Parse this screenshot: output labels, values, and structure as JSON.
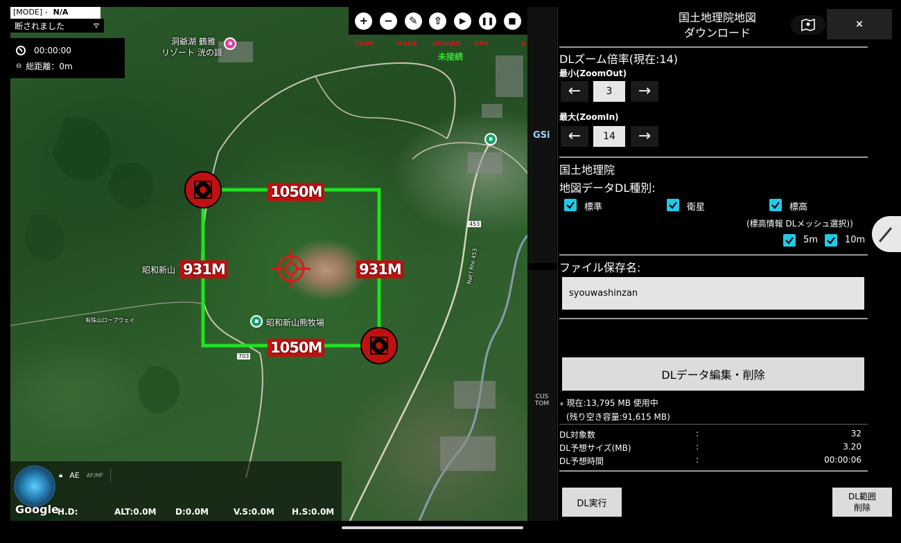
{
  "status": {
    "mode_label": "[MODE] -",
    "mode_value": "N/A",
    "connection": "断されました",
    "connection_glyph": "ᯤ",
    "timer": "00:00:00",
    "distance": "総距離：0m"
  },
  "toolbar": {
    "buttons": [
      "zoom-in",
      "zoom-out",
      "wrench",
      "upload",
      "play",
      "pause",
      "stop"
    ],
    "tags": [
      "TEMP",
      "MODE",
      "UPLOAD",
      "GPS",
      "S"
    ],
    "unconnected": "未接続"
  },
  "map": {
    "labels": {
      "hotel_line1": "洞爺湖 鶴雅",
      "hotel_line2": "リゾート 洸の謌",
      "mountain": "昭和新山",
      "ranch": "昭和新山熊牧場",
      "ropeway": "有珠山ロープウェイ",
      "route453": "453",
      "route453_vertical": "Nat'l Rte 453",
      "route703": "703"
    },
    "distances": {
      "top": "1050M",
      "bottom": "1050M",
      "left": "931M",
      "right": "931M"
    },
    "google": "Google",
    "colors": {
      "area_outline": "#22e022",
      "marker": "#c01010"
    }
  },
  "hud": {
    "ae": "AE",
    "af": "AF/MF",
    "hd": "H.D:",
    "alt": "ALT:0.0M",
    "d": "D:0.0M",
    "vs": "V.S:0.0M",
    "hs": "H.S:0.0M"
  },
  "strip": {
    "gsi": "GSi",
    "custom_1": "CUS",
    "custom_2": "TOM"
  },
  "panel": {
    "title_line1": "国土地理院地図",
    "title_line2": "ダウンロード",
    "close": "×",
    "zoom_title": "DLズーム倍率(現在:14)",
    "min_label": "最小(ZoomOut)",
    "min_value": "3",
    "max_label": "最大(ZoomIn)",
    "max_value": "14",
    "arrow_left": "←",
    "arrow_right": "→",
    "gsi_label": "国土地理院",
    "type_label": "地図データDL種別:",
    "types": [
      "標準",
      "衛星",
      "標高"
    ],
    "elevation_note": "(標高情報 DLメッシュ選択))",
    "mesh": [
      "5m",
      "10m"
    ],
    "file_label": "ファイル保存名:",
    "file_value": "syouwashinzan",
    "edit_button": "DLデータ編集・削除",
    "usage_line1": "現在:13,795 MB 使用中",
    "usage_line2": "(残り空き容量:91,615 MB)",
    "stats": [
      {
        "k": "DL対象数",
        "v": "32"
      },
      {
        "k": "DL予想サイズ(MB)",
        "v": "3.20"
      },
      {
        "k": "DL予想時間",
        "v": "00:00:06"
      }
    ],
    "colon": ":",
    "exec_button": "DL実行",
    "del_button_line1": "DL範囲",
    "del_button_line2": "削除"
  }
}
